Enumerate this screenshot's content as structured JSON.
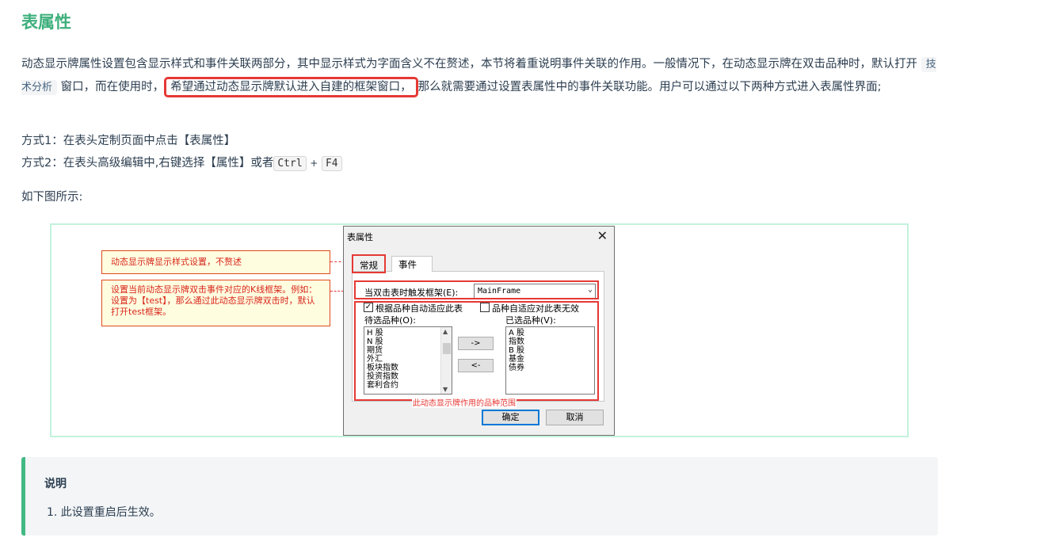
{
  "page_title": "表属性",
  "intro": {
    "part1": "动态显示牌属性设置包含显示样式和事件关联两部分，其中显示样式为字面含义不在赘述，本节将着重说明事件关联的作用。一般情况下，在动态显示牌在双击品种时，默认打开",
    "code": "技术分析",
    "part2": "窗口，而在使用时，",
    "highlight": "希望通过动态显示牌默认进入自建的框架窗口，",
    "part3": "那么就需要通过设置表属性中的事件关联功能。用户可以通过以下两种方式进入表属性界面;"
  },
  "methods": {
    "m1": "方式1：在表头定制页面中点击【表属性】",
    "m2_prefix": "方式2：在表头高级编辑中,右键选择【属性】或者",
    "key1": "Ctrl",
    "plus": "+",
    "key2": "F4"
  },
  "figure_caption": "如下图所示:",
  "callouts": {
    "style_note": "动态显示牌显示样式设置，不赘述",
    "event_note": "设置当前动态显示牌双击事件对应的K线框架。例如：设置为【test】，那么通过此动态显示牌双击时，默认打开test框架。"
  },
  "dialog": {
    "title": "表属性",
    "close_glyph": "✕",
    "tabs": [
      "常规",
      "事件"
    ],
    "frame_label": "当双击表时触发框架(E):",
    "frame_value": "MainFrame",
    "check_auto_label": "根据品种自动适应此表",
    "check_invalid_label": "品种自适应对此表无效",
    "pending_label": "待选品种(O):",
    "selected_label": "已选品种(V):",
    "pending_items": [
      "H 股",
      "N 股",
      "期货",
      "外汇",
      "板块指数",
      "投资指数",
      "套利合约"
    ],
    "selected_items": [
      "A 股",
      "指数",
      "B 股",
      "基金",
      "债券"
    ],
    "add_button": "->",
    "remove_button": "<-",
    "range_caption": "此动态显示牌作用的品种范围",
    "ok_button": "确定",
    "cancel_button": "取消"
  },
  "note": {
    "title": "说明",
    "items": [
      "1. 此设置重启后生效。"
    ]
  },
  "colors": {
    "accent": "#3eaf7c",
    "annotation_red": "#e53935",
    "frame_border": "#c3f2dc",
    "note_border": "#42b983"
  }
}
